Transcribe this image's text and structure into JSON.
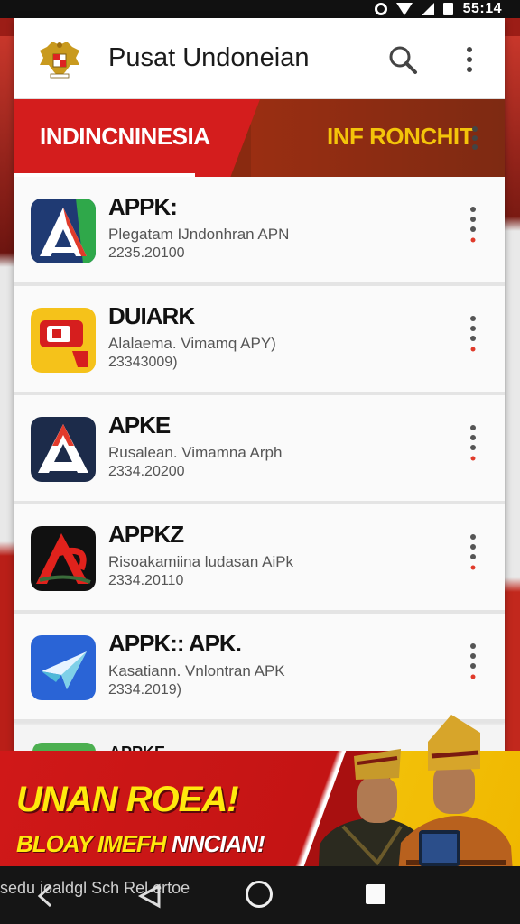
{
  "status_bar": {
    "time": "55:14"
  },
  "app_bar": {
    "title": "Pusat Undoneian"
  },
  "tabs": [
    {
      "label": "INDINCNINESIA",
      "active": true
    },
    {
      "label": "INF RONCHIT",
      "active": false
    }
  ],
  "apps": [
    {
      "name": "APPK:",
      "description": "Plegatam IJndonhran APN",
      "version": "2235.20100",
      "icon": "apk-a-green-red-icon"
    },
    {
      "name": "DUIARK",
      "description": "Alalaema. Vimamq APY)",
      "version": "23343009)",
      "icon": "apk-yellow-red-icon"
    },
    {
      "name": "APKE",
      "description": "Rusalean. Vimamna Arph",
      "version": "2334.20200",
      "icon": "apk-a-navy-icon"
    },
    {
      "name": "APPKZ",
      "description": "Risoakamiina ludasan AiPk",
      "version": "2334.20110",
      "icon": "apk-a-red-dark-icon"
    },
    {
      "name": "APPK:: APK.",
      "description": "Kasatiann. Vnlontran APK",
      "version": "2334.2019)",
      "icon": "apk-blue-paper-plane-icon"
    },
    {
      "name": "APPKE",
      "description": "",
      "version": "",
      "icon": "apk-green-icon"
    }
  ],
  "banner": {
    "title": "UNAN ROEA!",
    "subtitle_a": "BLOAY IMEFH",
    "subtitle_b": "NNCIAN!"
  },
  "nav_bar": {
    "overlay_text": "sedu ioaldgl Sch Rel ertoe"
  },
  "colors": {
    "primary_red": "#d41d1d",
    "accent_yellow": "#f4c40a",
    "dark_brown": "#8a2a10"
  }
}
